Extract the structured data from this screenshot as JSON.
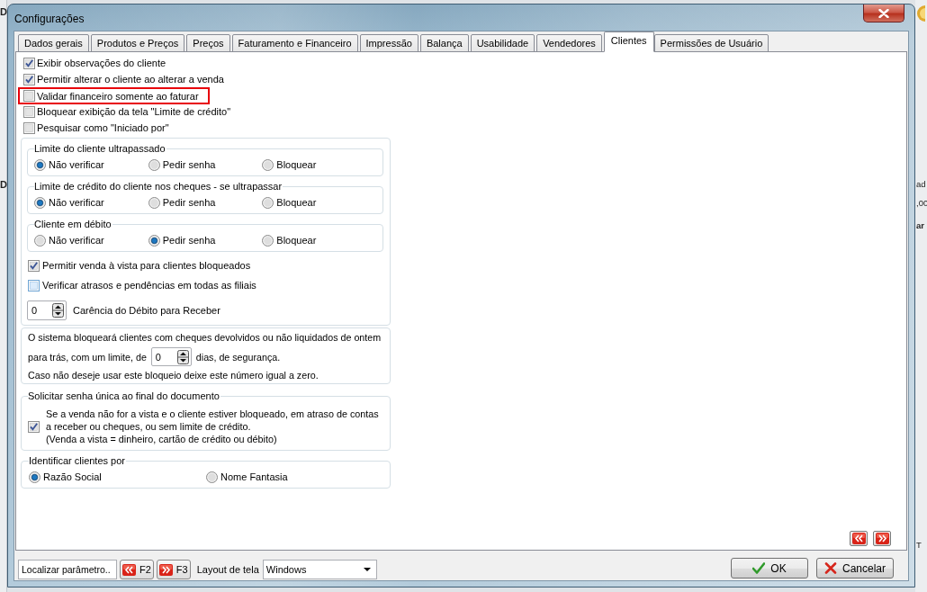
{
  "background_window": {
    "left_fragments": [
      "D",
      "D"
    ],
    "right_fragments": [
      "ad",
      ",00",
      "ar",
      "T"
    ]
  },
  "window": {
    "title": "Configurações"
  },
  "tabs": [
    {
      "label": "Dados gerais",
      "selected": false
    },
    {
      "label": "Produtos e Preços",
      "selected": false
    },
    {
      "label": "Preços",
      "selected": false
    },
    {
      "label": "Faturamento e Financeiro",
      "selected": false
    },
    {
      "label": "Impressão",
      "selected": false
    },
    {
      "label": "Balança",
      "selected": false
    },
    {
      "label": "Usabilidade",
      "selected": false
    },
    {
      "label": "Vendedores",
      "selected": false
    },
    {
      "label": "Clientes",
      "selected": true
    },
    {
      "label": "Permissões de Usuário",
      "selected": false
    }
  ],
  "options": [
    {
      "label": "Exibir observações do cliente",
      "checked": true,
      "highlighted": false
    },
    {
      "label": "Permitir alterar o cliente ao alterar a venda",
      "checked": true,
      "highlighted": false
    },
    {
      "label": "Validar financeiro somente ao faturar",
      "checked": false,
      "highlighted": true
    },
    {
      "label": "Bloquear exibição da tela \"Limite de crédito\"",
      "checked": false,
      "highlighted": false
    },
    {
      "label": "Pesquisar como \"Iniciado por\"",
      "checked": false,
      "highlighted": false
    }
  ],
  "radio_groups": [
    {
      "title": "Limite do cliente ultrapassado",
      "options": [
        {
          "label": "Não verificar",
          "selected": true
        },
        {
          "label": "Pedir senha",
          "selected": false
        },
        {
          "label": "Bloquear",
          "selected": false
        }
      ]
    },
    {
      "title": "Limite de crédito do cliente nos cheques - se ultrapassar",
      "options": [
        {
          "label": "Não verificar",
          "selected": true
        },
        {
          "label": "Pedir senha",
          "selected": false
        },
        {
          "label": "Bloquear",
          "selected": false
        }
      ]
    },
    {
      "title": "Cliente em débito",
      "options": [
        {
          "label": "Não verificar",
          "selected": false
        },
        {
          "label": "Pedir senha",
          "selected": true
        },
        {
          "label": "Bloquear",
          "selected": false
        }
      ]
    }
  ],
  "credit_options": [
    {
      "label": "Permitir venda à vista para clientes bloqueados",
      "checked": true,
      "hovered": false
    },
    {
      "label": "Verificar atrasos e pendências em todas as filiais",
      "checked": false,
      "hovered": true
    }
  ],
  "grace_period": {
    "value": "0",
    "label": "Carência do Débito para Receber"
  },
  "returned_checks_notice": {
    "line_1": "O sistema bloqueará clientes com cheques devolvidos ou não liquidados de ontem",
    "line_2_start": "para trás, com um limite, de",
    "days": "0",
    "line_2_end": "dias, de segurança.",
    "line_3": "Caso não deseje usar este bloqueio deixe este número igual a zero."
  },
  "single_password": {
    "title": "Solicitar senha única ao final do documento",
    "checked": true,
    "lines": [
      "Se a venda não for a vista e o cliente estiver bloqueado, em atraso de contas",
      "a receber ou cheques, ou sem limite de crédito.",
      "(Venda a vista = dinheiro, cartão de crédito ou débito)"
    ]
  },
  "identify_clients": {
    "title": "Identificar clientes por",
    "options": [
      {
        "label": "Razão Social",
        "selected": true
      },
      {
        "label": "Nome Fantasia",
        "selected": false
      }
    ]
  },
  "footer": {
    "search": {
      "placeholder": "Localizar parâmetro.."
    },
    "previous": {
      "key": "F2"
    },
    "next": {
      "key": "F3"
    },
    "layout": {
      "label": "Layout de tela",
      "value": "Windows"
    },
    "buttons": [
      {
        "kind": "ok",
        "label": "OK"
      },
      {
        "kind": "cancel",
        "label": "Cancelar"
      }
    ]
  }
}
